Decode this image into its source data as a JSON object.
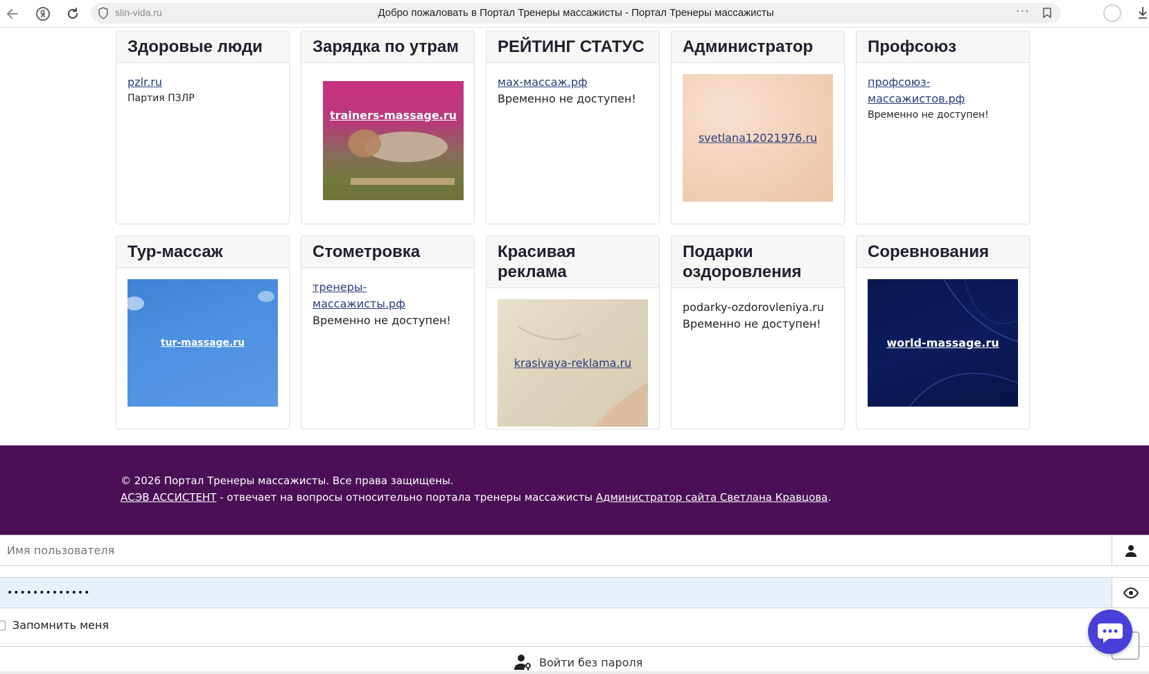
{
  "browser": {
    "domain": "slin-vida.ru",
    "title": "Добро пожаловать в Портал Тренеры массажисты - Портал Тренеры массажисты",
    "more": "···"
  },
  "cards": [
    {
      "title": "Здоровые люди",
      "link": "pzlr.ru",
      "text": "Партия ПЗЛР"
    },
    {
      "title": "Зарядка по утрам",
      "image_label": "trainers-massage.ru"
    },
    {
      "title": "РЕЙТИНГ СТАТУС",
      "link": "мах-массаж.рф",
      "text": "Временно не доступен!"
    },
    {
      "title": "Администратор",
      "image_label": "svetlana12021976.ru"
    },
    {
      "title": "Профсоюз",
      "link": "профсоюз-массажистов.рф",
      "text": "Временно не доступен!"
    },
    {
      "title": "Тур-массаж",
      "image_label": "tur-massage.ru"
    },
    {
      "title": "Стометровка",
      "link": "тренеры-массажисты.рф",
      "text": "Временно не доступен!"
    },
    {
      "title": "Красивая реклама",
      "image_label": "krasivaya-reklama.ru"
    },
    {
      "title": "Подарки оздоровления",
      "link": "podarky-ozdorovleniya.ru",
      "text": "Временно не доступен!"
    },
    {
      "title": "Соревнования",
      "image_label": "world-massage.ru"
    }
  ],
  "footer": {
    "copyright": "© 2026 Портал Тренеры массажисты. Все права защищены.",
    "assistant_link": "АСЭВ АССИСТЕНТ",
    "middle_text": " - отвечает на вопросы относительно портала тренеры массажисты ",
    "admin_link": "Администратор сайта Светлана Кравцова",
    "end": "."
  },
  "login": {
    "username_placeholder": "Имя пользователя",
    "password_value": "•••••••••••••",
    "remember_label": "Запомнить меня",
    "no_password_label": "Войти без пароля"
  },
  "colors": {
    "footer_bg": "#4b0f56",
    "chat_button": "#4a3fd8",
    "password_bg": "#e8f0fe",
    "link": "#283d7a"
  }
}
